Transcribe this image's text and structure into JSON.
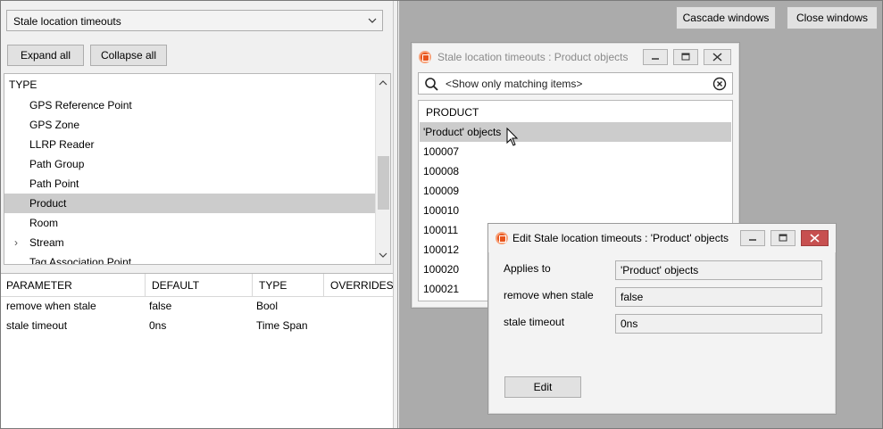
{
  "left": {
    "dropdown_value": "Stale location timeouts",
    "expand_all": "Expand all",
    "collapse_all": "Collapse all",
    "tree": {
      "header": "TYPE",
      "items": [
        {
          "label": "GPS Reference Point",
          "selected": false
        },
        {
          "label": "GPS Zone",
          "selected": false
        },
        {
          "label": "LLRP Reader",
          "selected": false
        },
        {
          "label": "Path Group",
          "selected": false
        },
        {
          "label": "Path Point",
          "selected": false
        },
        {
          "label": "Product",
          "selected": true
        },
        {
          "label": "Room",
          "selected": false
        },
        {
          "label": "Stream",
          "selected": false,
          "expandable": true
        },
        {
          "label": "Tag Association Point",
          "selected": false
        }
      ]
    },
    "params": {
      "headers": [
        "PARAMETER",
        "DEFAULT",
        "TYPE",
        "OVERRIDES"
      ],
      "rows": [
        [
          "remove when stale",
          "false",
          "Bool",
          ""
        ],
        [
          "stale timeout",
          "0ns",
          "Time Span",
          ""
        ]
      ]
    }
  },
  "mdi": {
    "cascade_windows": "Cascade windows",
    "close_windows": "Close windows"
  },
  "win1": {
    "title": "Stale location timeouts : Product objects",
    "filter_placeholder": "<Show only matching items>",
    "list_header": "PRODUCT",
    "items": [
      {
        "label": "'Product' objects",
        "selected": true
      },
      {
        "label": "100007"
      },
      {
        "label": "100008"
      },
      {
        "label": "100009"
      },
      {
        "label": "100010"
      },
      {
        "label": "100011"
      },
      {
        "label": "100012"
      },
      {
        "label": "100020"
      },
      {
        "label": "100021"
      }
    ]
  },
  "win2": {
    "title": "Edit Stale location timeouts : 'Product' objects",
    "fields": [
      {
        "label": "Applies to",
        "value": "'Product' objects"
      },
      {
        "label": "remove when stale",
        "value": "false"
      },
      {
        "label": "stale timeout",
        "value": "0ns"
      }
    ],
    "edit_button": "Edit"
  },
  "colors": {
    "selection": "#cccccc",
    "mdi_background": "#ababab",
    "close_active": "#c75050",
    "app_icon": "#e8541c"
  }
}
